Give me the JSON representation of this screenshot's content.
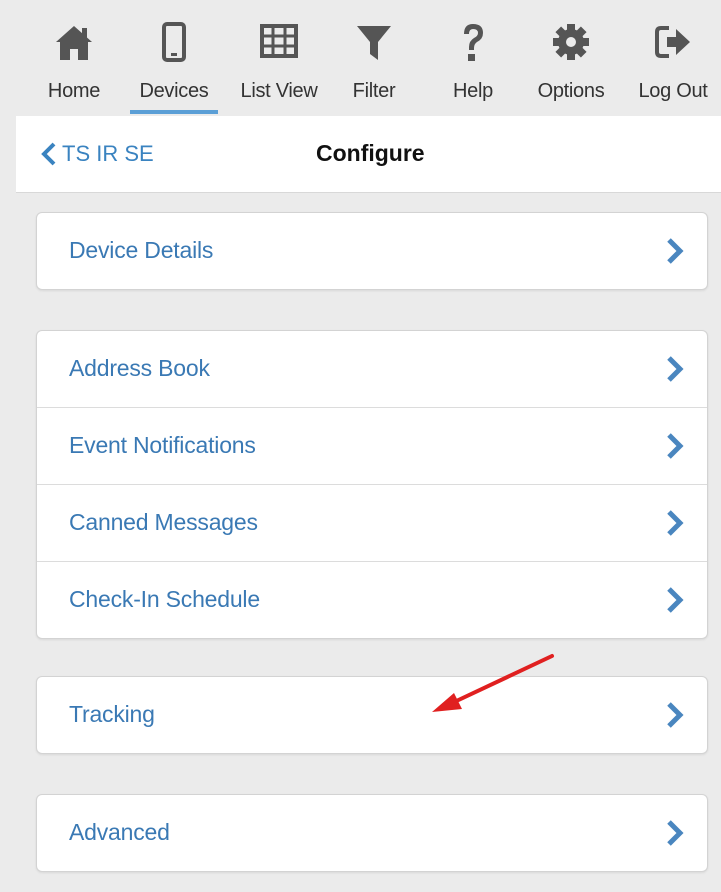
{
  "toolbar": {
    "items": [
      {
        "label": "Home",
        "icon": "home-icon"
      },
      {
        "label": "Devices",
        "icon": "mobile-device-icon"
      },
      {
        "label": "List View",
        "icon": "grid-table-icon"
      },
      {
        "label": "Filter",
        "icon": "funnel-filter-icon"
      },
      {
        "label": "Help",
        "icon": "question-mark-icon"
      },
      {
        "label": "Options",
        "icon": "gear-icon"
      },
      {
        "label": "Log Out",
        "icon": "sign-out-icon"
      }
    ],
    "active_item": "Devices",
    "icon_color": "#555555",
    "active_underline_color": "#5b9fd6"
  },
  "header": {
    "back_label": "TS IR SE",
    "title": "Configure"
  },
  "menu": {
    "group_1": [
      {
        "label": "Device Details"
      }
    ],
    "group_2": [
      {
        "label": "Address Book"
      },
      {
        "label": "Event Notifications"
      },
      {
        "label": "Canned Messages"
      },
      {
        "label": "Check-In Schedule"
      }
    ],
    "group_3": [
      {
        "label": "Tracking"
      }
    ],
    "group_4": [
      {
        "label": "Advanced"
      }
    ]
  },
  "colors": {
    "link_text": "#3a79b4",
    "chevron": "#4a86bf",
    "annotation_arrow": "#e02020",
    "background": "#ebebeb"
  }
}
